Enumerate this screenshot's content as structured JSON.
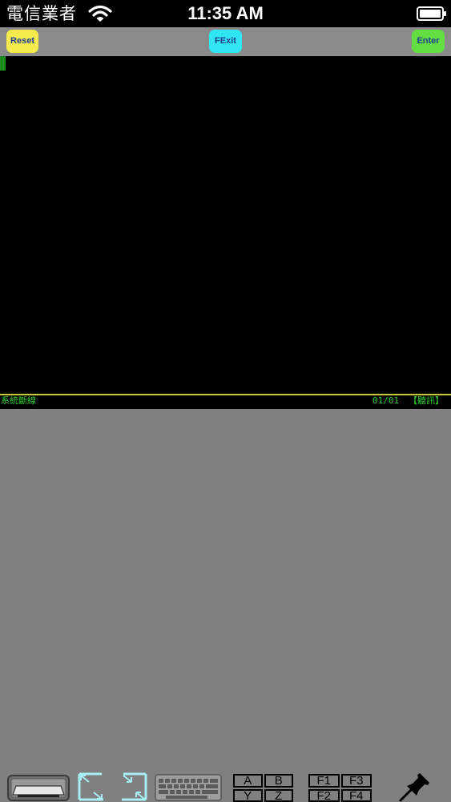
{
  "status_bar": {
    "carrier": "電信業者",
    "time": "11:35 AM",
    "icons": [
      "wifi-icon",
      "battery-icon"
    ]
  },
  "toolbar": {
    "reset_label": "Reset",
    "fexit_label": "FExit",
    "enter_label": "Enter"
  },
  "terminal": {
    "status_left": "系統斷線",
    "page_indicator": "01/01",
    "mode_label": "【聽訊】"
  },
  "bottom_toolbar": {
    "icons": [
      "tray-icon",
      "shrink-arrows-icon",
      "expand-arrows-icon",
      "keyboard-icon",
      "letter-keys-icon",
      "function-keys-icon",
      "pushpin-icon"
    ],
    "letter_keys": [
      "A",
      "B",
      "Y",
      "Z"
    ],
    "function_keys": [
      "F1",
      "F3",
      "F2",
      "F4"
    ]
  },
  "colors": {
    "reset": "#f5ea4c",
    "fexit": "#2fe6f2",
    "enter": "#63de41",
    "terminal_text": "#2fcf2f",
    "divider": "#c8c834",
    "panel": "#808080",
    "toolbar": "#8a8a8a"
  }
}
